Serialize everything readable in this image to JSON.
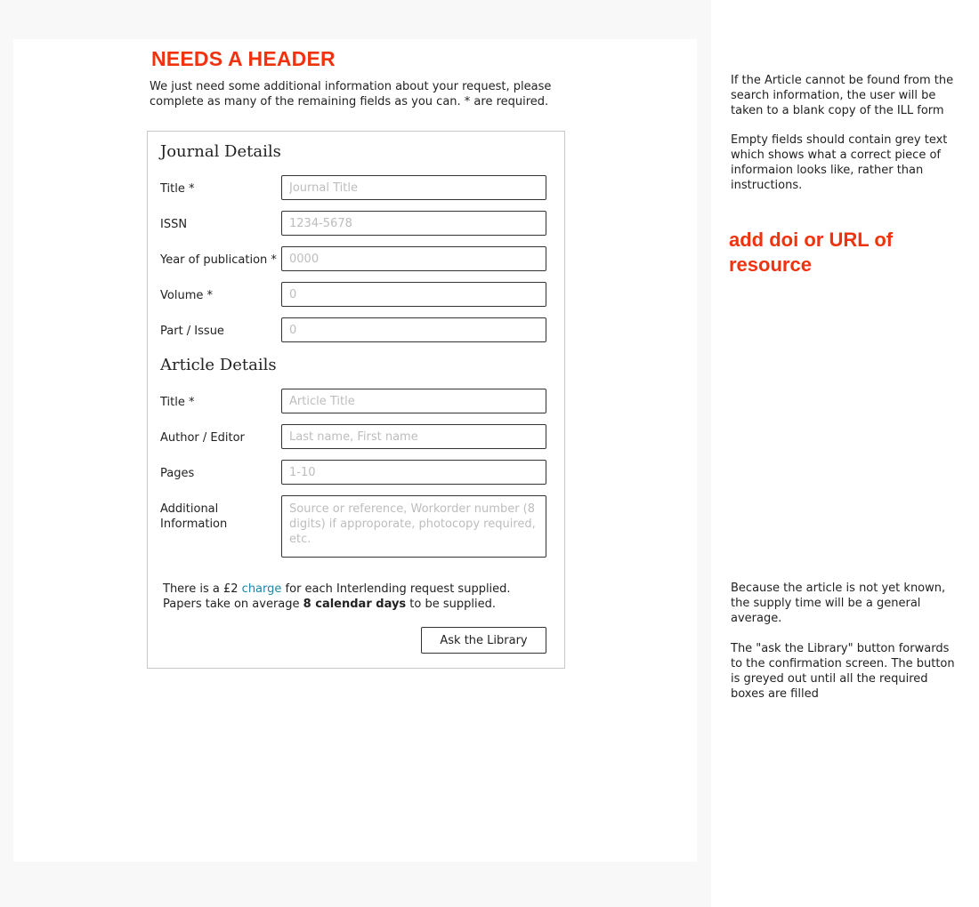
{
  "header_note": "NEEDS A HEADER",
  "intro": "We just need some additional information about your request, please complete as many of the remaining fields as you can. * are required.",
  "journal": {
    "heading": "Journal Details",
    "title_label": "Title *",
    "title_placeholder": "Journal Title",
    "issn_label": "ISSN",
    "issn_placeholder": "1234-5678",
    "year_label": "Year of publication *",
    "year_placeholder": "0000",
    "volume_label": "Volume *",
    "volume_placeholder": "0",
    "issue_label": "Part / Issue",
    "issue_placeholder": "0"
  },
  "article": {
    "heading": "Article Details",
    "title_label": "Title *",
    "title_placeholder": "Article Title",
    "author_label": "Author / Editor",
    "author_placeholder": "Last name, First name",
    "pages_label": "Pages",
    "pages_placeholder": "1-10",
    "additional_label": "Additional Information",
    "additional_placeholder": "Source or reference, Workorder number (8 digits) if approporate, photocopy required, etc."
  },
  "info": {
    "charge_prefix": "There is a £2 ",
    "charge_link": "charge",
    "charge_suffix": " for each Interlending request supplied.",
    "supply_prefix": "Papers take on average ",
    "supply_days": "8 calendar days",
    "supply_suffix": " to be supplied."
  },
  "submit_label": "Ask the Library",
  "annotations": {
    "not_found": "If the Article cannot be found from the search information, the user will be taken to a blank copy of the ILL form",
    "empty_fields": "Empty fields should contain grey text which shows what a correct piece of informaion looks like, rather than instructions.",
    "add_doi": "add doi or URL of resource",
    "supply_time": "Because the article is not yet known, the supply time will be a general average.",
    "button_note": "The \"ask the Library\" button forwards to the confirmation screen. The button is greyed out until all the required boxes are filled"
  },
  "colors": {
    "annotation_red": "#f0330f",
    "link_blue": "#1a86a8",
    "canvas_grey": "#f8f8f8"
  }
}
